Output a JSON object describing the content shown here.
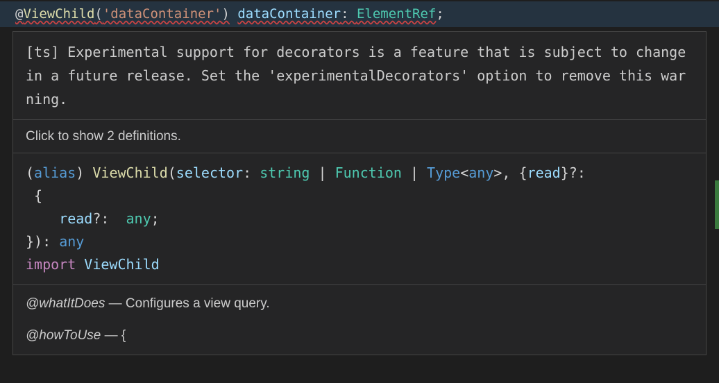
{
  "code": {
    "at": "@",
    "decorator": "ViewChild",
    "lparen": "(",
    "string": "'dataContainer'",
    "rparen": ")",
    "space": " ",
    "ident": "dataContainer",
    "colon": ": ",
    "type": "ElementRef",
    "semi": ";"
  },
  "hover": {
    "warning": "[ts] Experimental support for decorators is a feature that is subject to change in a future release. Set the 'experimentalDecorators' option to remove this warning.",
    "definitions_link": "Click to show 2 definitions.",
    "signature": {
      "lparen": "(",
      "alias": "alias",
      "rparen_space": ") ",
      "name": "ViewChild",
      "call_lparen": "(",
      "selector_label": "selector",
      "colon_space": ": ",
      "string_t": "string",
      "pipe": " | ",
      "function_t": "Function",
      "pipe2": " | ",
      "type_kw": "Type",
      "lt": "<",
      "any1": "any",
      "gt": ">",
      "comma": ", ",
      "lbrace": "{",
      "read_label": "read",
      "rbrace": "}",
      "q": "?",
      "colon2": ":",
      "nl_indent": "\n ",
      "lbrace2": "{",
      "nl_indent2": "\n    ",
      "read2": "read",
      "q2": "?",
      "colon3": ":  ",
      "any2": "any",
      "semi_inner": ";",
      "nl": "\n",
      "rbrace2": "}",
      "rparen2": ")",
      "colon4": ": ",
      "any3": "any",
      "nl2": "\n",
      "import_kw": "import",
      "space_import": " ",
      "import_name": "ViewChild"
    },
    "doc": {
      "whatItDoes_tag": "@whatItDoes",
      "dash": " — ",
      "whatItDoes_text": "Configures a view query.",
      "howToUse_tag": "@howToUse",
      "howToUse_text": "{"
    }
  }
}
